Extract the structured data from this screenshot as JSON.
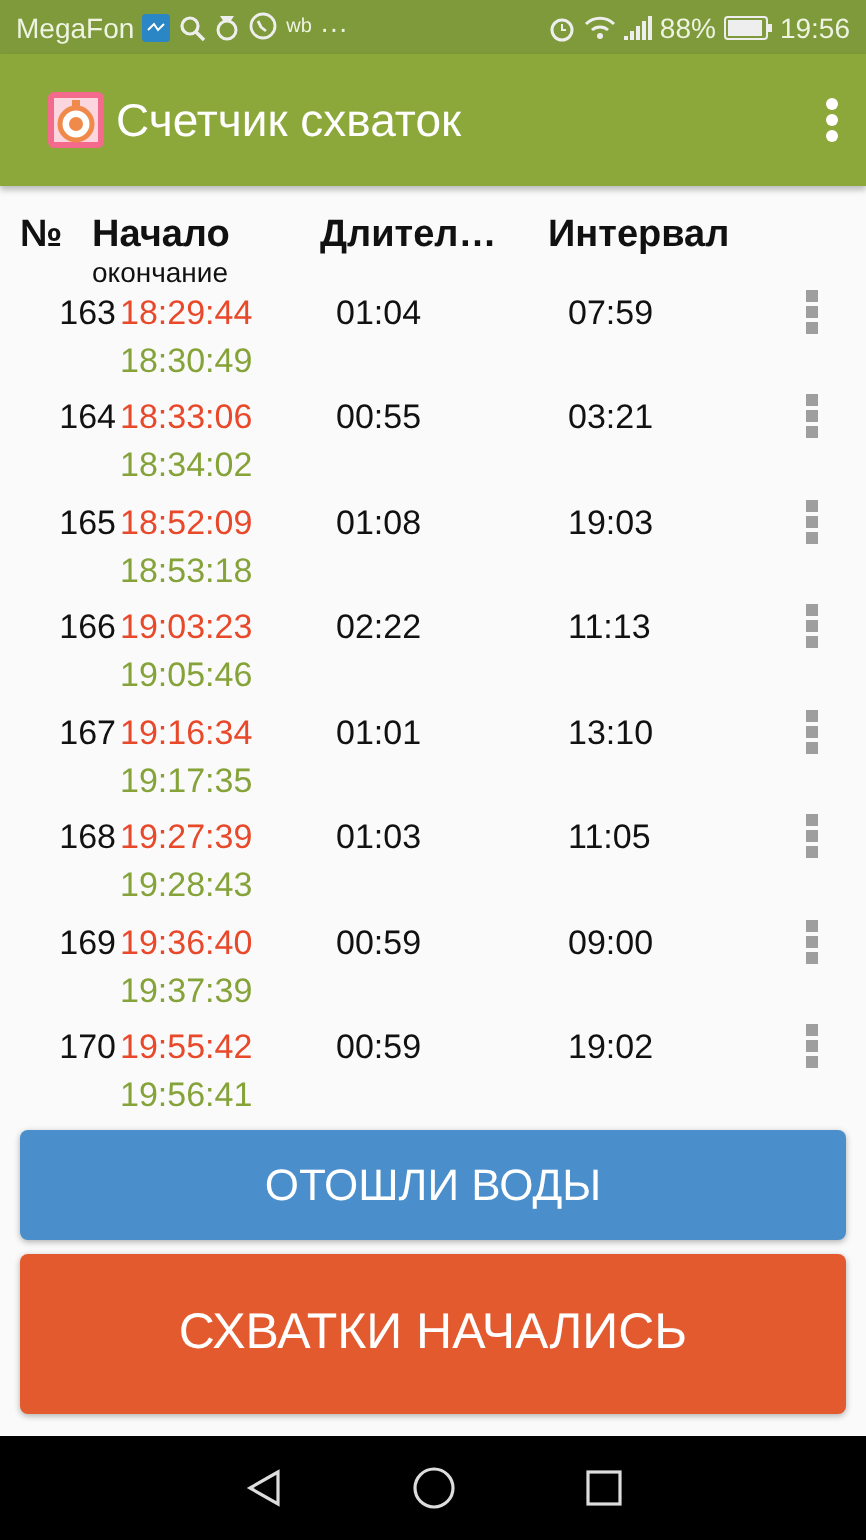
{
  "status_bar": {
    "carrier": "MegaFon",
    "notification_text": "wb",
    "more": "···",
    "battery": "88%",
    "time": "19:56"
  },
  "app_bar": {
    "title": "Счетчик схваток"
  },
  "table": {
    "columns": [
      {
        "label": "№"
      },
      {
        "label": "Начало",
        "sublabel": "окончание"
      },
      {
        "label": "Длител…"
      },
      {
        "label": "Интервал"
      }
    ],
    "rows": [
      {
        "number": "163",
        "start": "18:29:44",
        "end": "18:30:49",
        "duration": "01:04",
        "interval": "07:59"
      },
      {
        "number": "164",
        "start": "18:33:06",
        "end": "18:34:02",
        "duration": "00:55",
        "interval": "03:21"
      },
      {
        "number": "165",
        "start": "18:52:09",
        "end": "18:53:18",
        "duration": "01:08",
        "interval": "19:03"
      },
      {
        "number": "166",
        "start": "19:03:23",
        "end": "19:05:46",
        "duration": "02:22",
        "interval": "11:13"
      },
      {
        "number": "167",
        "start": "19:16:34",
        "end": "19:17:35",
        "duration": "01:01",
        "interval": "13:10"
      },
      {
        "number": "168",
        "start": "19:27:39",
        "end": "19:28:43",
        "duration": "01:03",
        "interval": "11:05"
      },
      {
        "number": "169",
        "start": "19:36:40",
        "end": "19:37:39",
        "duration": "00:59",
        "interval": "09:00"
      },
      {
        "number": "170",
        "start": "19:55:42",
        "end": "19:56:41",
        "duration": "00:59",
        "interval": "19:02"
      }
    ]
  },
  "buttons": [
    {
      "label": "ОТОШЛИ ВОДЫ",
      "kind": "water"
    },
    {
      "label": "СХВАТКИ НАЧАЛИСЬ",
      "kind": "contractions"
    }
  ]
}
